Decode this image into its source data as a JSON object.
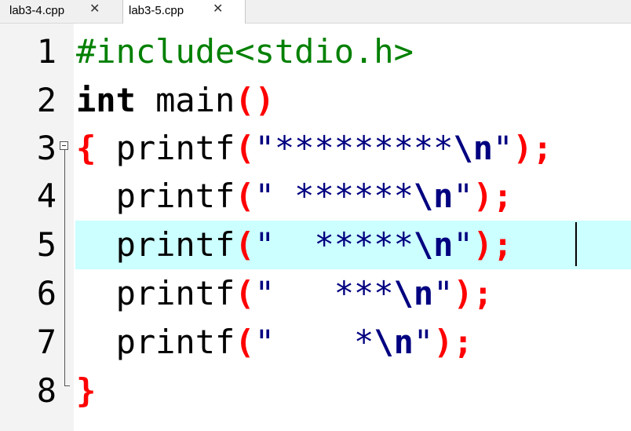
{
  "tabs": [
    {
      "label": "lab3-4.cpp",
      "close": "✕"
    },
    {
      "label": "lab3-5.cpp",
      "close": "✕"
    }
  ],
  "line_numbers": [
    "1",
    "2",
    "3",
    "4",
    "5",
    "6",
    "7",
    "8"
  ],
  "code": {
    "l1": {
      "directive": "#include<stdio.h>"
    },
    "l2": {
      "type": "int",
      "name": " main",
      "open": "(",
      "close": ")"
    },
    "l3": {
      "brace": "{",
      "fn": " printf",
      "open": "(",
      "str": "\"*********",
      "esc": "\\n",
      "str_end": "\"",
      "close": ");"
    },
    "l4": {
      "fn": "  printf",
      "open": "(",
      "str": "\" ******",
      "esc": "\\n",
      "str_end": "\"",
      "close": ");"
    },
    "l5": {
      "fn": "  printf",
      "open": "(",
      "str": "\"  *****",
      "esc": "\\n",
      "str_end": "\"",
      "close": ");"
    },
    "l6": {
      "fn": "  printf",
      "open": "(",
      "str": "\"   ***",
      "esc": "\\n",
      "str_end": "\"",
      "close": ");"
    },
    "l7": {
      "fn": "  printf",
      "open": "(",
      "str": "\"    *",
      "esc": "\\n",
      "str_end": "\"",
      "close": ");"
    },
    "l8": {
      "brace": "}"
    }
  },
  "current_line_color": "#ccffff",
  "icons": [
    "close-icon",
    "fold-toggle-icon"
  ]
}
